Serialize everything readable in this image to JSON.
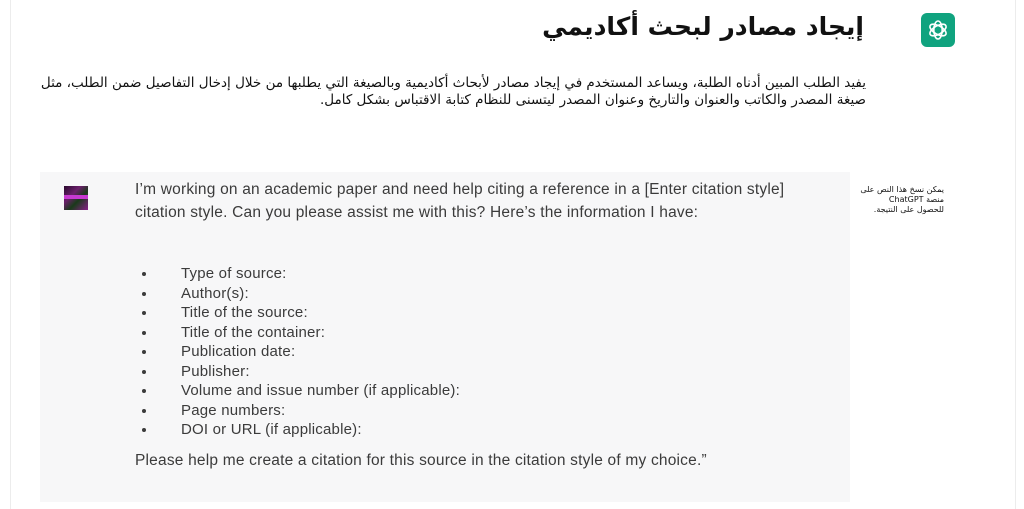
{
  "page": {
    "title": "إيجاد مصادر لبحث أكاديمي",
    "description": "يفيد الطلب المبين أدناه الطلبة، ويساعد المستخدم في إيجاد مصادر لأبحاث أكاديمية وبالصيغة التي يطلبها من خلال إدخال التفاصيل ضمن الطلب، مثل صيغة المصدر والكاتب والعنوان والتاريخ وعنوان المصدر ليتسنى للنظام كتابة الاقتباس بشكل كامل."
  },
  "logo": {
    "icon": "openai-logo-icon",
    "color": "#10a37f"
  },
  "prompt": {
    "avatar": "user-avatar",
    "intro": "I’m working on an academic paper and need help citing a reference in a [Enter citation style] citation style. Can you please assist me with this? Here’s the information I have:",
    "fields": [
      "Type of source:",
      "Author(s):",
      "Title of the source:",
      "Title of the container:",
      "Publication date:",
      "Publisher:",
      "Volume and issue number (if applicable):",
      "Page numbers:",
      "DOI or URL (if applicable):"
    ],
    "closing": "Please help me create a citation for this source in the citation style of my choice.”"
  },
  "side_note": "يمكن نسخ هذا النص على منصة ChatGPT للحصول على النتيجة."
}
